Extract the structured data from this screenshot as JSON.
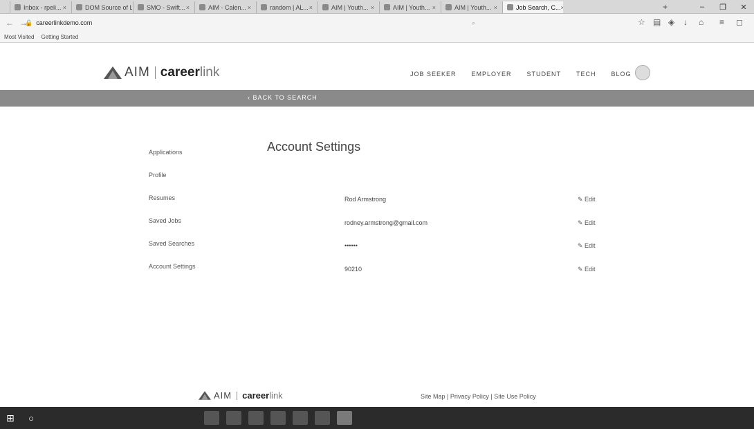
{
  "browser": {
    "tabs": [
      {
        "label": "Inbox - rpeli...",
        "active": false
      },
      {
        "label": "DOM Source of L...",
        "active": false
      },
      {
        "label": "SMO - Swift...",
        "active": false
      },
      {
        "label": "AIM - Calen...",
        "active": false
      },
      {
        "label": "random | AL...",
        "active": false
      },
      {
        "label": "AIM | Youth...",
        "active": false
      },
      {
        "label": "AIM | Youth...",
        "active": false
      },
      {
        "label": "AIM | Youth...",
        "active": false
      },
      {
        "label": "Job Search, C...",
        "active": true
      }
    ],
    "url_host": "careerlinkdemo.com",
    "bookmarks": [
      "Most Visited",
      "Getting Started"
    ]
  },
  "site": {
    "logo_aim": "AIM",
    "logo_career": "career",
    "logo_link": "link",
    "nav": [
      "JOB SEEKER",
      "EMPLOYER",
      "STUDENT",
      "TECH",
      "BLOG"
    ],
    "back_label": "BACK TO SEARCH",
    "sidenav": [
      "Applications",
      "Profile",
      "Resumes",
      "Saved Jobs",
      "Saved Searches",
      "Account Settings"
    ],
    "page_title": "Account Settings",
    "fields": [
      {
        "value": "Rod Armstrong",
        "edit": "Edit"
      },
      {
        "value": "rodney.armstrong@gmail.com",
        "edit": "Edit"
      },
      {
        "value": "••••••",
        "edit": "Edit"
      },
      {
        "value": "90210",
        "edit": "Edit"
      }
    ],
    "footer_links": "Site Map | Privacy Policy | Site Use Policy"
  }
}
